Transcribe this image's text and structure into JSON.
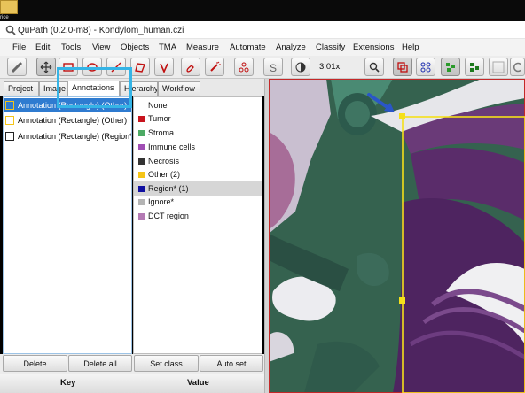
{
  "desktop": {
    "icon_label": "rice"
  },
  "window": {
    "title": "QuPath (0.2.0-m8) - Kondylom_human.czi"
  },
  "menu": [
    "File",
    "Edit",
    "Tools",
    "View",
    "Objects",
    "TMA",
    "Measure",
    "Automate",
    "Analyze",
    "Classify",
    "Extensions",
    "Help"
  ],
  "toolbar": {
    "zoom": "3.01x",
    "tools": [
      "measure-tool-icon",
      "move-tool-icon",
      "rectangle-tool-icon",
      "ellipse-tool-icon",
      "line-tool-icon",
      "polygon-tool-icon",
      "polyline-tool-icon",
      "brush-tool-icon",
      "wand-tool-icon",
      "points-tool-icon",
      "selection-mode-icon",
      "brightness-contrast-icon",
      "zoom-to-fit-icon",
      "show-annotations-icon",
      "show-tma-grid-icon",
      "show-detections-icon",
      "fill-detections-icon",
      "show-pixel-classification-icon"
    ]
  },
  "tabs": [
    "Project",
    "Image",
    "Annotations",
    "Hierarchy",
    "Workflow"
  ],
  "active_tab": "Annotations",
  "annotations": [
    {
      "label": "Annotation (Rectangle) (Other)",
      "color": "#f5c518",
      "selected": true
    },
    {
      "label": "Annotation (Rectangle) (Other)",
      "color": "#f5c518",
      "selected": false
    },
    {
      "label": "Annotation (Rectangle) (Region*)",
      "color": "#222222",
      "selected": false
    }
  ],
  "classes": [
    {
      "label": "None",
      "color": ""
    },
    {
      "label": "Tumor",
      "color": "#c8141e"
    },
    {
      "label": "Stroma",
      "color": "#4caa64"
    },
    {
      "label": "Immune cells",
      "color": "#a04eb4"
    },
    {
      "label": "Necrosis",
      "color": "#333333"
    },
    {
      "label": "Other (2)",
      "color": "#f5c518"
    },
    {
      "label": "Region* (1)",
      "color": "#1010a0",
      "selected": true
    },
    {
      "label": "Ignore*",
      "color": "#b4b4b4"
    },
    {
      "label": "DCT region",
      "color": "#b47ab4"
    }
  ],
  "buttons": {
    "delete": "Delete",
    "delete_all": "Delete all",
    "set_class": "Set class",
    "auto_set": "Auto set"
  },
  "measurement_table": {
    "key_header": "Key",
    "value_header": "Value"
  },
  "colors": {
    "selection_blue": "#2f7bd0",
    "callout": "#35b4e6",
    "annotation_yellow": "#f5e01a",
    "arrow": "#2a56c8"
  }
}
